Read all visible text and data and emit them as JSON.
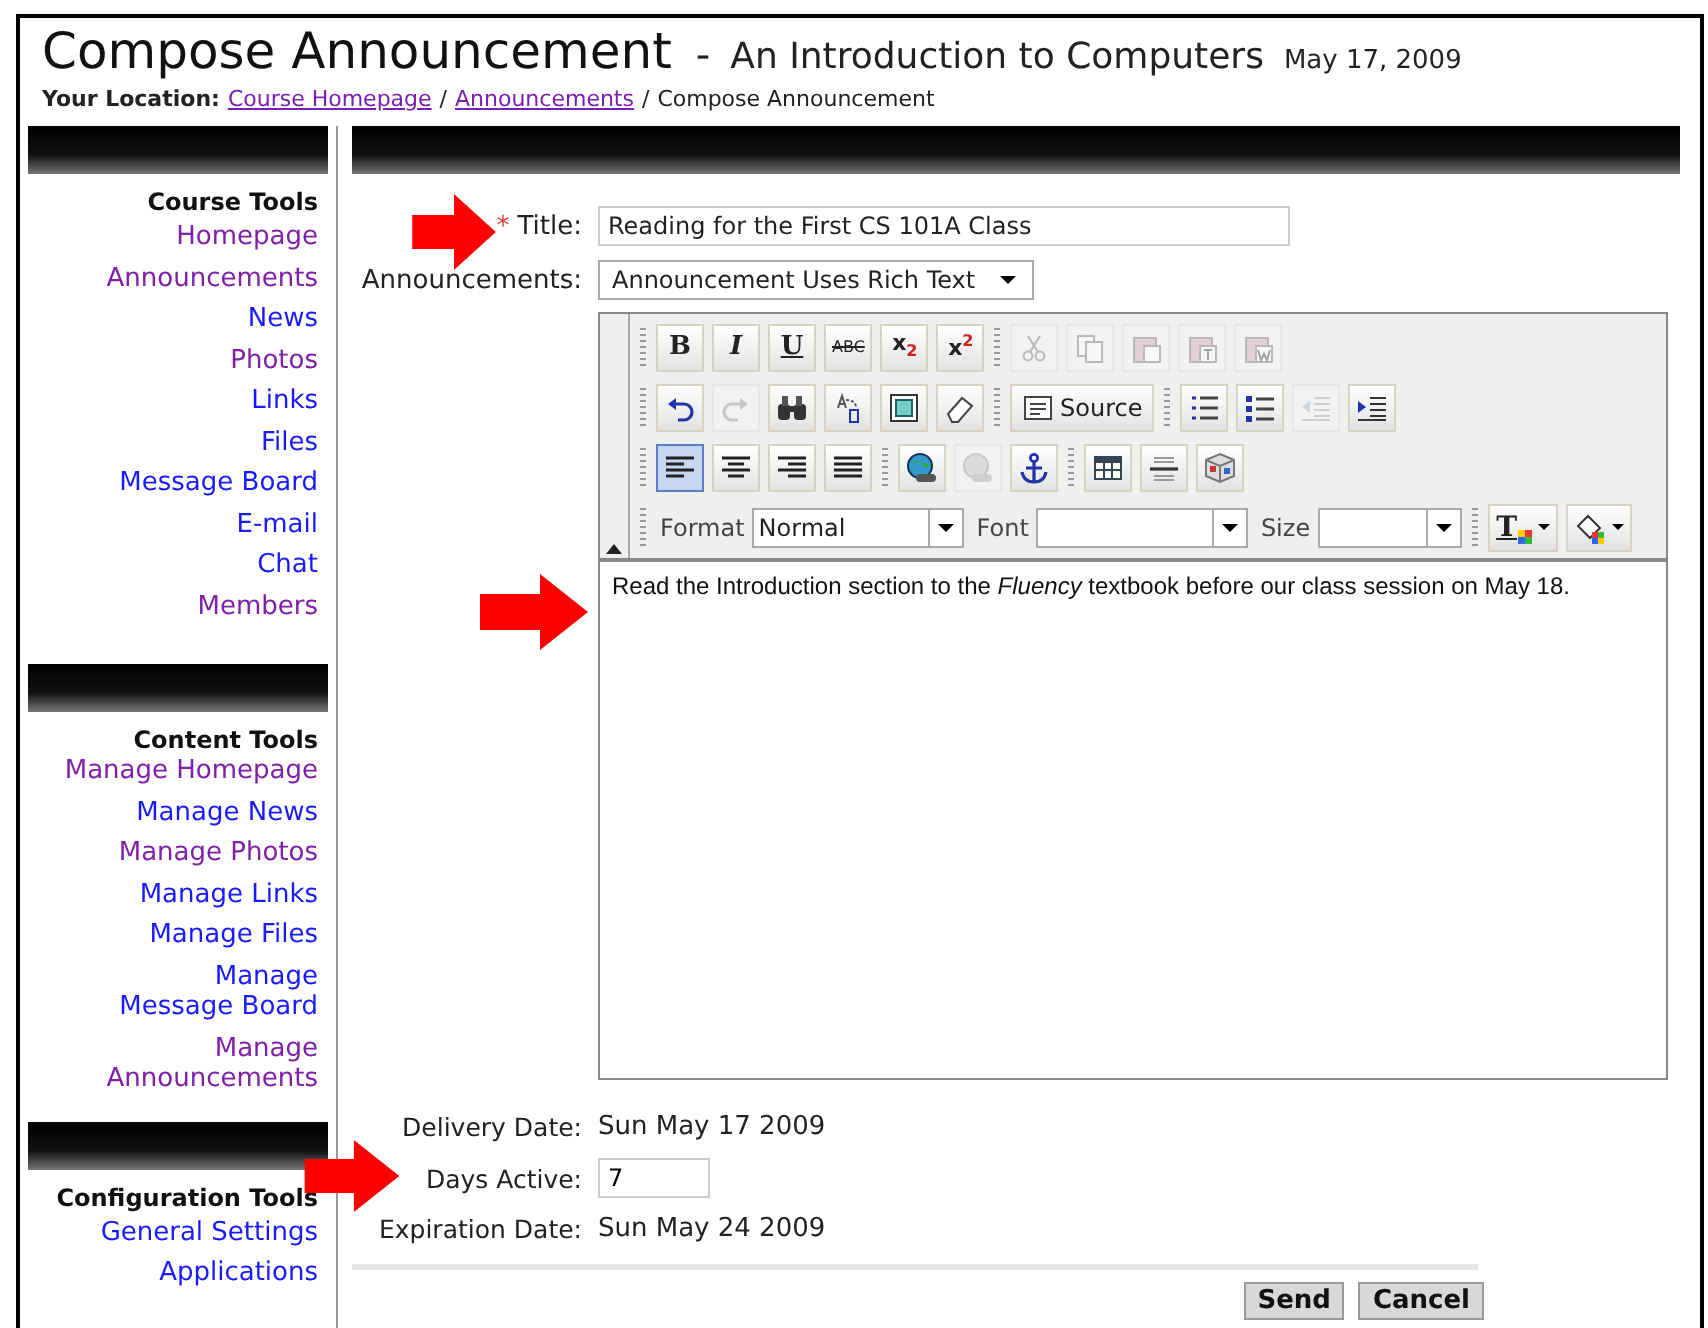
{
  "header": {
    "title": "Compose Announcement",
    "separator": "-",
    "course": "An Introduction to Computers",
    "date": "May 17, 2009"
  },
  "breadcrumb": {
    "label": "Your Location:",
    "items": [
      {
        "label": "Course Homepage",
        "kind": "link"
      },
      {
        "label": "/",
        "kind": "separator"
      },
      {
        "label": "Announcements",
        "kind": "link"
      },
      {
        "label": "/",
        "kind": "separator"
      },
      {
        "label": "Compose Announcement",
        "kind": "current"
      }
    ]
  },
  "sidebar": [
    {
      "heading": "Course Tools",
      "links": [
        {
          "label": "Homepage",
          "visited": true
        },
        {
          "label": "Announcements",
          "visited": true
        },
        {
          "label": "News",
          "visited": false
        },
        {
          "label": "Photos",
          "visited": true
        },
        {
          "label": "Links",
          "visited": false
        },
        {
          "label": "Files",
          "visited": false
        },
        {
          "label": "Message Board",
          "visited": false
        },
        {
          "label": "E-mail",
          "visited": false
        },
        {
          "label": "Chat",
          "visited": false
        },
        {
          "label": "Members",
          "visited": true
        }
      ]
    },
    {
      "heading": "Content Tools",
      "links": [
        {
          "label": "Manage Homepage",
          "visited": true
        },
        {
          "label": "Manage News",
          "visited": false
        },
        {
          "label": "Manage Photos",
          "visited": true
        },
        {
          "label": "Manage Links",
          "visited": false
        },
        {
          "label": "Manage Files",
          "visited": false
        },
        {
          "label": "Manage\nMessage Board",
          "visited": false
        },
        {
          "label": "Manage\nAnnouncements",
          "visited": true
        }
      ]
    },
    {
      "heading": "Configuration Tools",
      "links": [
        {
          "label": "General Settings",
          "visited": false
        },
        {
          "label": "Applications",
          "visited": false
        }
      ]
    }
  ],
  "form": {
    "title": {
      "label": "Title:",
      "required_mark": "*",
      "value": "Reading for the First CS 101A Class"
    },
    "mode": {
      "label": "Announcements:",
      "value": "Announcement Uses Rich Text"
    },
    "toolbar": [
      [
        {
          "buttons": [
            {
              "kind": "bold",
              "label": "B",
              "disabled": false,
              "on": false
            },
            {
              "kind": "italic",
              "label": "I",
              "disabled": false,
              "on": false
            },
            {
              "kind": "underline",
              "label": "U",
              "disabled": false,
              "on": false
            },
            {
              "kind": "strike",
              "label": "ABC",
              "disabled": false,
              "on": false
            },
            {
              "kind": "subscript",
              "label": "x$_{2}$",
              "disabled": false,
              "on": false
            },
            {
              "kind": "superscript",
              "label": "x$^{2}$",
              "disabled": false,
              "on": false
            }
          ]
        },
        {
          "buttons": [
            {
              "kind": "cut",
              "disabled": true,
              "on": false
            },
            {
              "kind": "copy",
              "disabled": true,
              "on": false
            },
            {
              "kind": "paste",
              "disabled": true,
              "on": false
            },
            {
              "kind": "paste-text",
              "disabled": true,
              "on": false
            },
            {
              "kind": "paste-word",
              "disabled": true,
              "on": false
            }
          ]
        }
      ],
      [
        {
          "buttons": [
            {
              "kind": "undo",
              "disabled": false,
              "on": false
            },
            {
              "kind": "redo",
              "disabled": true,
              "on": false
            },
            {
              "kind": "find",
              "disabled": false,
              "on": false
            },
            {
              "kind": "replace",
              "disabled": false,
              "on": false
            },
            {
              "kind": "select-all",
              "disabled": false,
              "on": false
            },
            {
              "kind": "eraser",
              "disabled": false,
              "on": false
            }
          ]
        },
        {
          "buttons": [
            {
              "kind": "source",
              "label": "Source",
              "disabled": false,
              "on": false
            }
          ]
        },
        {
          "buttons": [
            {
              "kind": "numbered-list",
              "disabled": false,
              "on": false
            },
            {
              "kind": "bulleted-list",
              "disabled": false,
              "on": false
            },
            {
              "kind": "outdent",
              "disabled": true,
              "on": false
            },
            {
              "kind": "indent",
              "disabled": false,
              "on": false
            }
          ]
        }
      ],
      [
        {
          "buttons": [
            {
              "kind": "align-left",
              "disabled": false,
              "on": true
            },
            {
              "kind": "align-center",
              "disabled": false,
              "on": false
            },
            {
              "kind": "align-right",
              "disabled": false,
              "on": false
            },
            {
              "kind": "justify",
              "disabled": false,
              "on": false
            }
          ]
        },
        {
          "buttons": [
            {
              "kind": "link",
              "disabled": false,
              "on": false
            },
            {
              "kind": "unlink",
              "disabled": true,
              "on": false
            },
            {
              "kind": "anchor",
              "disabled": false,
              "on": false
            }
          ]
        },
        {
          "buttons": [
            {
              "kind": "table",
              "disabled": false,
              "on": false
            },
            {
              "kind": "rule",
              "disabled": false,
              "on": false
            },
            {
              "kind": "cube",
              "disabled": false,
              "on": false
            }
          ]
        }
      ],
      [
        {
          "buttons": [
            {
              "kind": "combo",
              "label": "Format",
              "value": "Normal"
            },
            {
              "kind": "combo",
              "label": "Font"
            },
            {
              "kind": "combo",
              "label": "Size"
            }
          ]
        },
        {
          "buttons": [
            {
              "kind": "text-color",
              "label": "T",
              "disabled": false,
              "on": false
            },
            {
              "kind": "fill-color",
              "disabled": false,
              "on": false
            }
          ]
        }
      ]
    ],
    "body": "Read the Introduction section to the *Fluency* textbook before our class session on May 18.",
    "delivery": {
      "label": "Delivery Date:",
      "value": "Sun May 17 2009"
    },
    "days": {
      "label": "Days Active:",
      "value": "7"
    },
    "expiration": {
      "label": "Expiration Date:",
      "value": "Sun May 24 2009"
    },
    "buttons": [
      "Send",
      "Cancel"
    ]
  }
}
